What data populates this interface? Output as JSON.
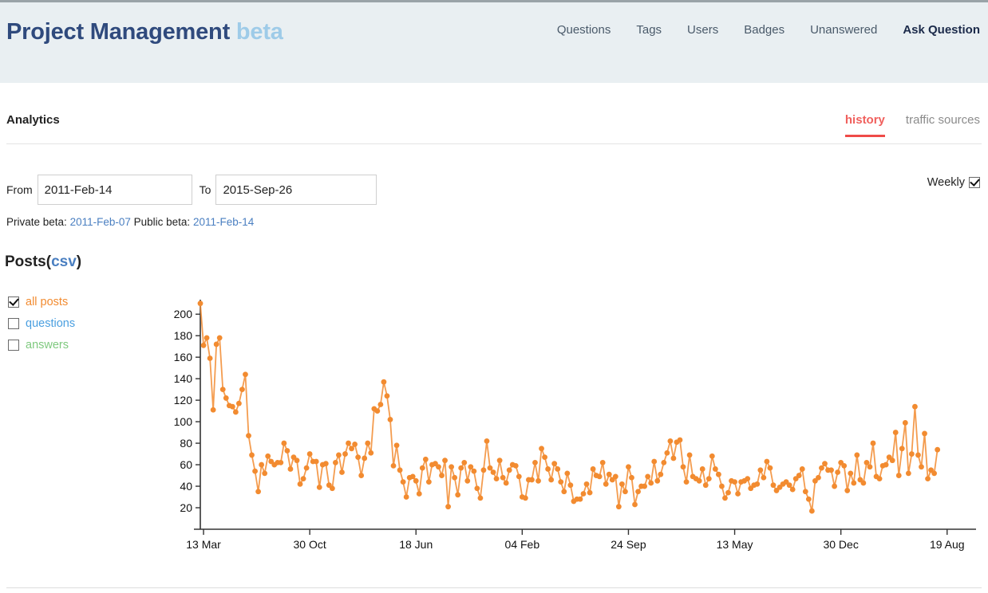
{
  "header": {
    "site_name": "Project Management",
    "site_beta": "beta",
    "nav": [
      {
        "label": "Questions",
        "active": false
      },
      {
        "label": "Tags",
        "active": false
      },
      {
        "label": "Users",
        "active": false
      },
      {
        "label": "Badges",
        "active": false
      },
      {
        "label": "Unanswered",
        "active": false
      },
      {
        "label": "Ask Question",
        "active": true
      }
    ]
  },
  "page": {
    "title": "Analytics",
    "tabs": [
      {
        "label": "history",
        "active": true
      },
      {
        "label": "traffic sources",
        "active": false
      }
    ]
  },
  "filters": {
    "from_label": "From",
    "from_value": "2011-Feb-14",
    "from_placeholder": "yyyy-Mon-dd",
    "to_label": "To",
    "to_value": "2015-Sep-26",
    "to_placeholder": "yyyy-Mon-dd",
    "weekly_label": "Weekly",
    "weekly_checked": "true",
    "private_beta_label": "Private beta:",
    "private_beta_date": "2011-Feb-07",
    "public_beta_label": "Public beta:",
    "public_beta_date": "2011-Feb-14"
  },
  "posts": {
    "heading": "Posts",
    "csv_open": "(",
    "csv_label": "csv",
    "csv_close": ")",
    "series": [
      {
        "label": "all posts",
        "color": "#f28b30",
        "checked": "true"
      },
      {
        "label": "questions",
        "color": "#4a9fe0",
        "checked": "false"
      },
      {
        "label": "answers",
        "color": "#7ec97e",
        "checked": "false"
      }
    ]
  },
  "chart_data": {
    "type": "line",
    "title": "Posts",
    "xlabel": "",
    "ylabel": "",
    "grid": false,
    "legend_position": "left",
    "series_name": "all posts",
    "series_color": "#f28b30",
    "marker": "circle",
    "ylim": [
      0,
      212
    ],
    "yticks": [
      20,
      40,
      60,
      80,
      100,
      120,
      140,
      160,
      180,
      200
    ],
    "xtick_labels": [
      "13 Mar",
      "30 Oct",
      "18 Jun",
      "04 Feb",
      "24 Sep",
      "13 May",
      "30 Dec",
      "19 Aug"
    ],
    "xtick_indices": [
      1,
      34,
      67,
      100,
      133,
      166,
      199,
      232
    ],
    "x_count": 240,
    "values": [
      210,
      171,
      178,
      159,
      111,
      172,
      178,
      130,
      122,
      115,
      114,
      109,
      117,
      130,
      144,
      87,
      69,
      54,
      35,
      60,
      52,
      68,
      63,
      60,
      62,
      62,
      80,
      73,
      56,
      67,
      64,
      42,
      47,
      57,
      70,
      63,
      63,
      39,
      60,
      61,
      41,
      38,
      62,
      69,
      53,
      70,
      80,
      75,
      79,
      67,
      50,
      66,
      80,
      71,
      112,
      110,
      116,
      137,
      124,
      102,
      59,
      78,
      55,
      44,
      30,
      48,
      49,
      45,
      33,
      57,
      65,
      44,
      60,
      61,
      58,
      50,
      64,
      21,
      58,
      48,
      32,
      57,
      62,
      45,
      58,
      54,
      38,
      29,
      55,
      82,
      57,
      53,
      47,
      64,
      48,
      43,
      55,
      60,
      59,
      49,
      30,
      29,
      46,
      46,
      62,
      45,
      75,
      67,
      56,
      46,
      61,
      56,
      44,
      35,
      52,
      41,
      26,
      28,
      28,
      33,
      42,
      34,
      56,
      50,
      49,
      62,
      42,
      51,
      46,
      49,
      21,
      42,
      35,
      58,
      48,
      23,
      35,
      40,
      40,
      49,
      43,
      63,
      45,
      51,
      62,
      71,
      82,
      66,
      81,
      83,
      58,
      44,
      69,
      49,
      47,
      45,
      56,
      41,
      47,
      68,
      56,
      51,
      40,
      29,
      34,
      45,
      44,
      33,
      44,
      45,
      47,
      38,
      41,
      42,
      55,
      48,
      63,
      57,
      41,
      36,
      39,
      42,
      44,
      41,
      37,
      47,
      50,
      56,
      35,
      28,
      17,
      45,
      48,
      57,
      61,
      55,
      55,
      40,
      53,
      62,
      59,
      36,
      52,
      43,
      69,
      46,
      43,
      62,
      58,
      80,
      49,
      47,
      59,
      60,
      67,
      64,
      90,
      50,
      75,
      99,
      52,
      70,
      114,
      69,
      58,
      89,
      47,
      55,
      52,
      74
    ]
  }
}
